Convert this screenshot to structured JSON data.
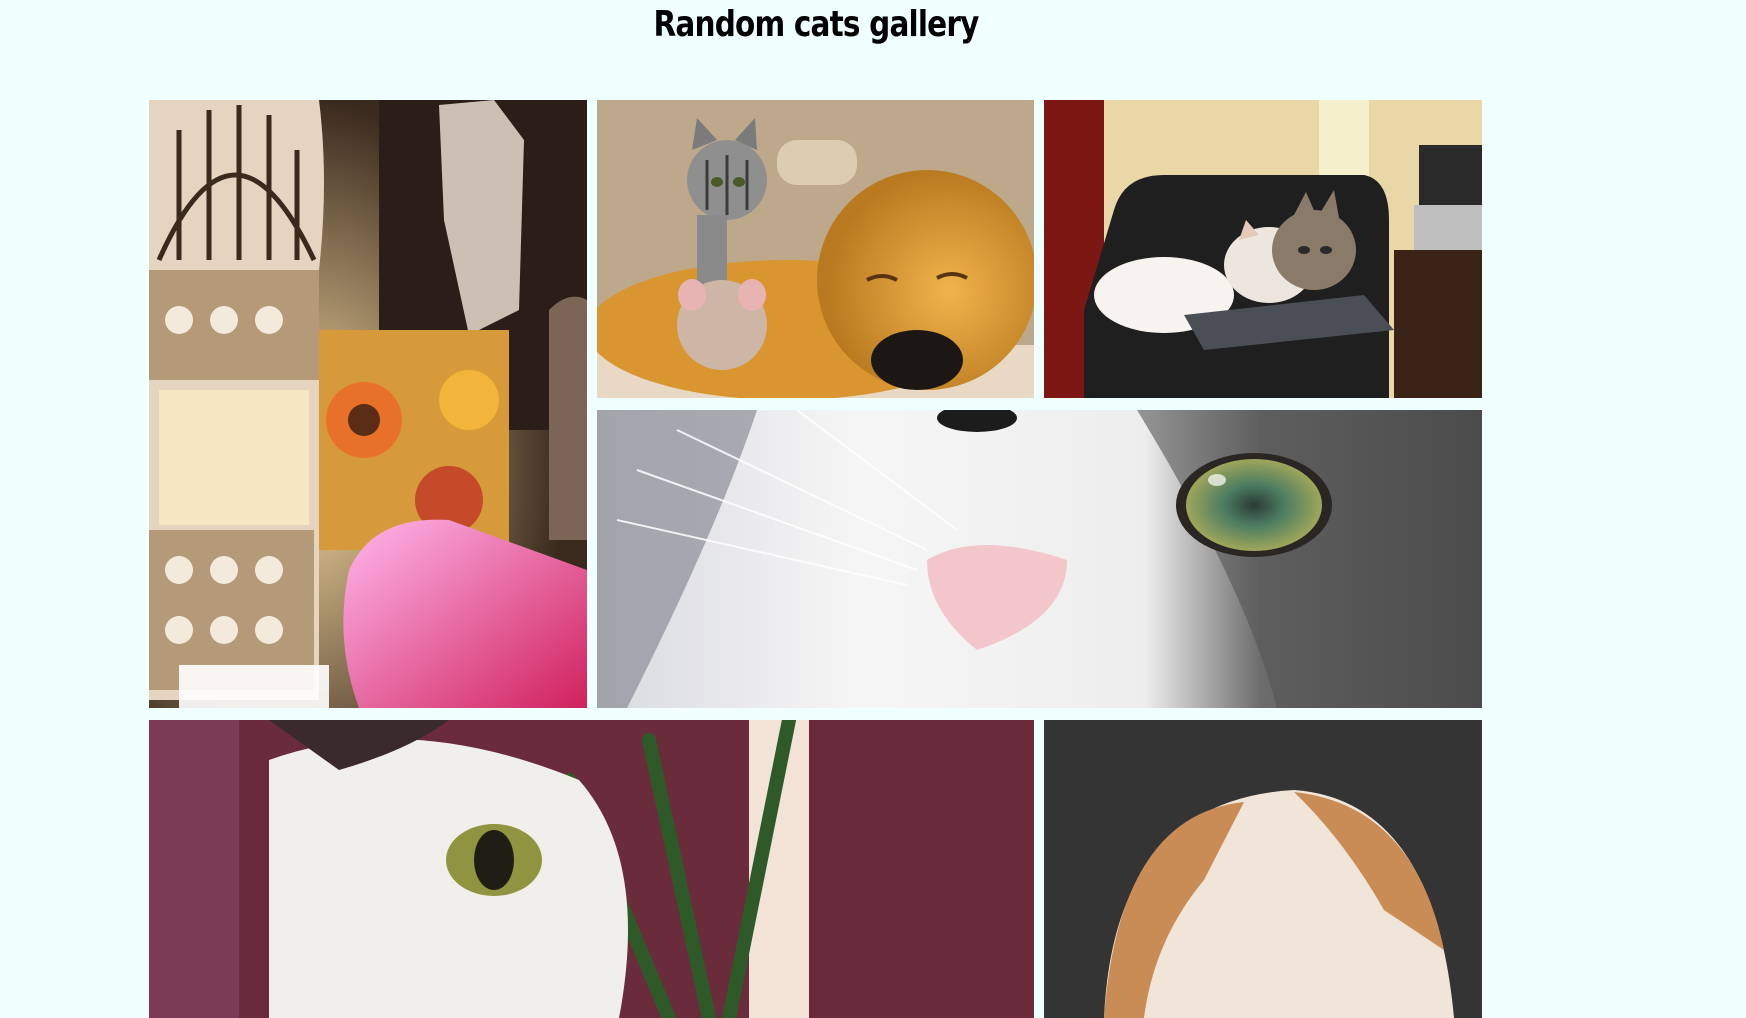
{
  "page": {
    "title": "Random cats gallery",
    "background": "#f0ffff"
  },
  "gallery": {
    "images": [
      {
        "subject": "cat-behind-lantern-and-tissue-box",
        "layout": "tall"
      },
      {
        "subject": "kitten-and-rat-on-sleeping-golden-retriever",
        "layout": "standard"
      },
      {
        "subject": "two-cats-on-black-armchair",
        "layout": "standard"
      },
      {
        "subject": "cat-face-closeup-green-eye",
        "layout": "wide"
      },
      {
        "subject": "white-cat-near-plant-closeup",
        "layout": "wide"
      },
      {
        "subject": "orange-white-cat-on-dark-fabric",
        "layout": "standard"
      }
    ]
  }
}
